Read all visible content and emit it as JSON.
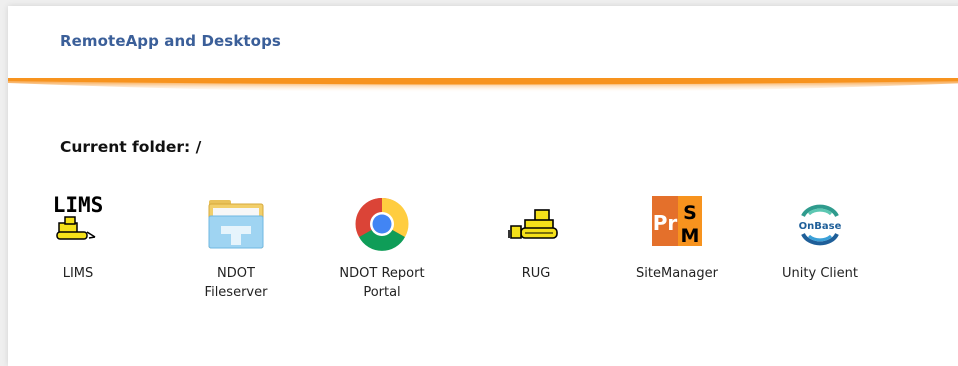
{
  "header": {
    "title": "RemoteApp and Desktops",
    "accent_color": "#f7931e",
    "title_color": "#3b5f99"
  },
  "folder": {
    "label": "Current folder: /"
  },
  "apps": [
    {
      "label": "LIMS",
      "icon": "lims-icon"
    },
    {
      "label": "NDOT\nFileserver",
      "icon": "folder-icon"
    },
    {
      "label": "NDOT Report\nPortal",
      "icon": "chrome-icon"
    },
    {
      "label": "RUG",
      "icon": "bulldozer-icon"
    },
    {
      "label": "SiteManager",
      "icon": "sitemanager-icon"
    },
    {
      "label": "Unity Client",
      "icon": "onbase-icon"
    }
  ],
  "icon_text": {
    "lims": "LIMS",
    "sitemanager_pr": "Pr",
    "sitemanager_s": "S",
    "sitemanager_m": "M",
    "onbase": "OnBase"
  }
}
